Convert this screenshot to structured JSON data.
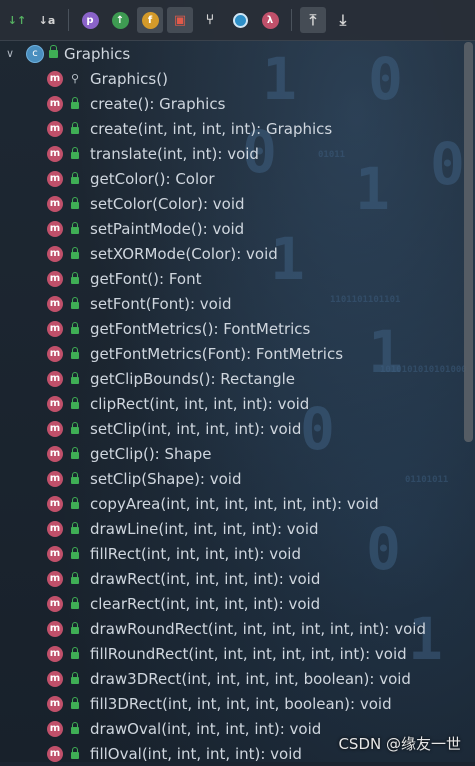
{
  "toolbar": {
    "buttons": [
      {
        "name": "sort-by-visibility-icon",
        "glyph": "↓↑"
      },
      {
        "name": "sort-alphabetically-icon",
        "glyph": "↓a"
      },
      {
        "name": "show-properties-icon",
        "glyph": "p",
        "color": "#8a63c9"
      },
      {
        "name": "show-inherited-icon",
        "glyph": "↑",
        "color": "#3e9b52"
      },
      {
        "name": "show-fields-icon",
        "glyph": "f",
        "color": "#d49a2a"
      },
      {
        "name": "show-non-public-icon",
        "glyph": "🔒",
        "color": "#d9534f"
      },
      {
        "name": "show-lambdas-icon",
        "glyph": "Y"
      },
      {
        "name": "show-anonymous-icon",
        "glyph": "●",
        "color": "#3a9bd6"
      },
      {
        "name": "show-lambda-icon",
        "glyph": "λ",
        "color": "#c0506a"
      },
      {
        "name": "expand-all-icon",
        "glyph": "⇡"
      },
      {
        "name": "collapse-all-icon",
        "glyph": "⇣"
      }
    ]
  },
  "tree": {
    "root_label": "Graphics",
    "items": [
      {
        "label": "Graphics()",
        "vis": "pin"
      },
      {
        "label": "create(): Graphics",
        "vis": "lock"
      },
      {
        "label": "create(int, int, int, int): Graphics",
        "vis": "lock"
      },
      {
        "label": "translate(int, int): void",
        "vis": "lock"
      },
      {
        "label": "getColor(): Color",
        "vis": "lock"
      },
      {
        "label": "setColor(Color): void",
        "vis": "lock"
      },
      {
        "label": "setPaintMode(): void",
        "vis": "lock"
      },
      {
        "label": "setXORMode(Color): void",
        "vis": "lock"
      },
      {
        "label": "getFont(): Font",
        "vis": "lock"
      },
      {
        "label": "setFont(Font): void",
        "vis": "lock"
      },
      {
        "label": "getFontMetrics(): FontMetrics",
        "vis": "lock"
      },
      {
        "label": "getFontMetrics(Font): FontMetrics",
        "vis": "lock"
      },
      {
        "label": "getClipBounds(): Rectangle",
        "vis": "lock"
      },
      {
        "label": "clipRect(int, int, int, int): void",
        "vis": "lock"
      },
      {
        "label": "setClip(int, int, int, int): void",
        "vis": "lock"
      },
      {
        "label": "getClip(): Shape",
        "vis": "lock"
      },
      {
        "label": "setClip(Shape): void",
        "vis": "lock"
      },
      {
        "label": "copyArea(int, int, int, int, int, int): void",
        "vis": "lock"
      },
      {
        "label": "drawLine(int, int, int, int): void",
        "vis": "lock"
      },
      {
        "label": "fillRect(int, int, int, int): void",
        "vis": "lock"
      },
      {
        "label": "drawRect(int, int, int, int): void",
        "vis": "lock"
      },
      {
        "label": "clearRect(int, int, int, int): void",
        "vis": "lock"
      },
      {
        "label": "drawRoundRect(int, int, int, int, int, int): void",
        "vis": "lock"
      },
      {
        "label": "fillRoundRect(int, int, int, int, int, int): void",
        "vis": "lock"
      },
      {
        "label": "draw3DRect(int, int, int, int, boolean): void",
        "vis": "lock"
      },
      {
        "label": "fill3DRect(int, int, int, int, boolean): void",
        "vis": "lock"
      },
      {
        "label": "drawOval(int, int, int, int): void",
        "vis": "lock"
      },
      {
        "label": "fillOval(int, int, int, int): void",
        "vis": "lock"
      }
    ]
  },
  "watermark": "CSDN @缘友一世",
  "colors": {
    "method_icon": "#c0506a",
    "public_lock": "#3fae55",
    "class_icon": "#4a8fbf"
  }
}
